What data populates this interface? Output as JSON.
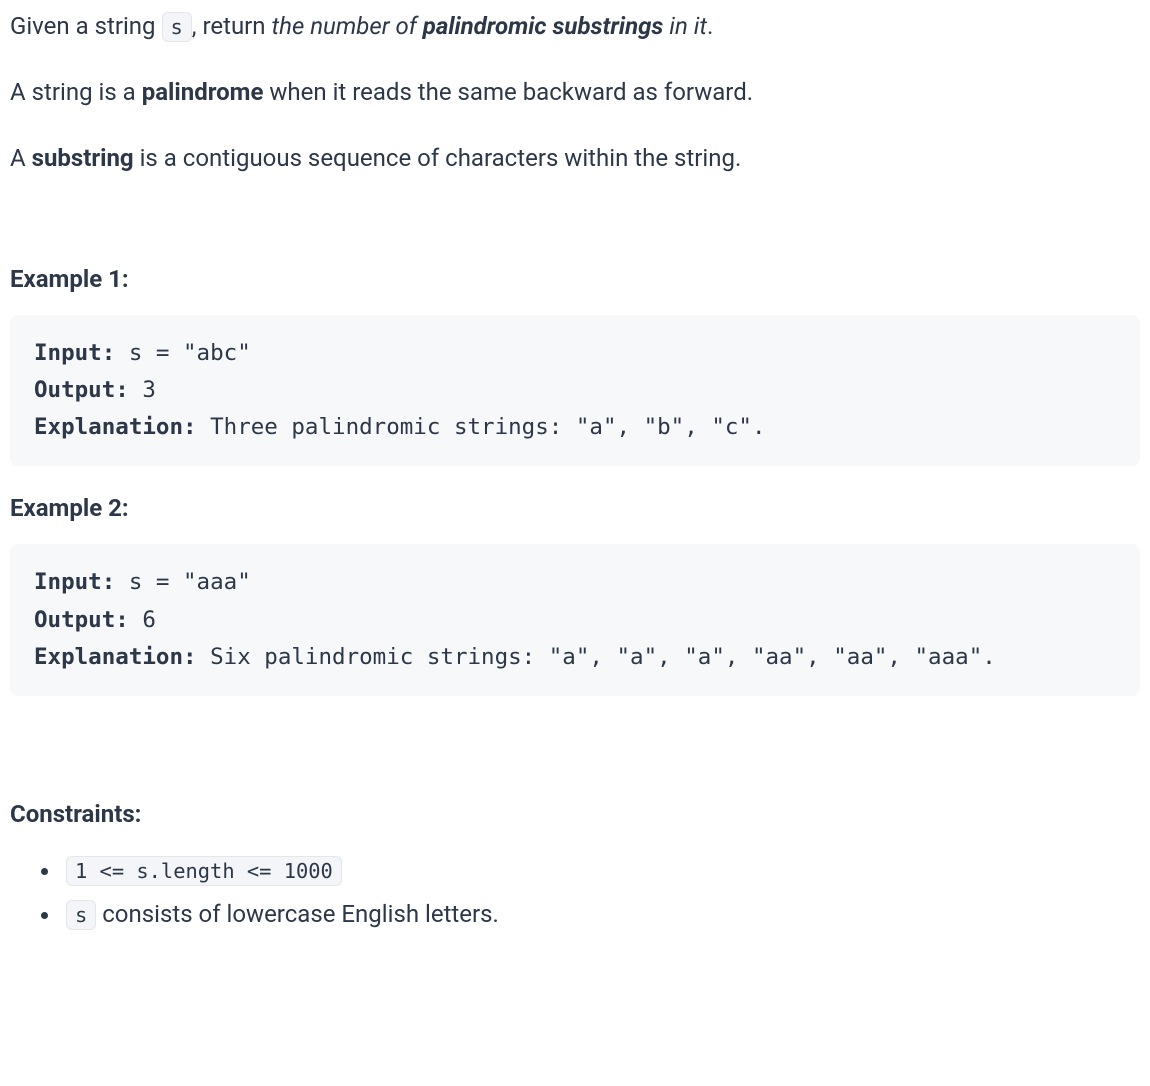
{
  "intro": {
    "p1_pre": "Given a string ",
    "p1_code": "s",
    "p1_post1": ", return ",
    "p1_em_pre": "the number of ",
    "p1_em_strong": "palindromic substrings",
    "p1_em_post": " in it",
    "p1_tail": ".",
    "p2_pre": "A string is a ",
    "p2_strong": "palindrome",
    "p2_post": " when it reads the same backward as forward.",
    "p3_pre": "A ",
    "p3_strong": "substring",
    "p3_post": " is a contiguous sequence of characters within the string."
  },
  "examples": [
    {
      "heading": "Example 1:",
      "input_label": "Input:",
      "input_val": " s = \"abc\"",
      "output_label": "Output:",
      "output_val": " 3",
      "expl_label": "Explanation:",
      "expl_val": " Three palindromic strings: \"a\", \"b\", \"c\"."
    },
    {
      "heading": "Example 2:",
      "input_label": "Input:",
      "input_val": " s = \"aaa\"",
      "output_label": "Output:",
      "output_val": " 6",
      "expl_label": "Explanation:",
      "expl_val": " Six palindromic strings: \"a\", \"a\", \"a\", \"aa\", \"aa\", \"aaa\"."
    }
  ],
  "constraints": {
    "heading": "Constraints:",
    "items": [
      {
        "code": "1 <= s.length <= 1000",
        "text": ""
      },
      {
        "code": "s",
        "text": " consists of lowercase English letters."
      }
    ]
  }
}
